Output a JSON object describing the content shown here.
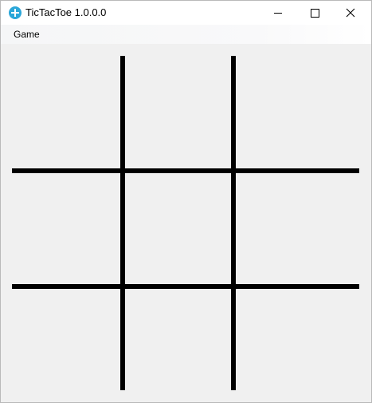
{
  "window": {
    "title": "TicTacToe 1.0.0.0",
    "app_icon": "tictactoe-app-icon",
    "controls": [
      "minimize-icon",
      "maximize-icon",
      "close-icon"
    ]
  },
  "menu": {
    "items": [
      {
        "label": "Game"
      }
    ]
  },
  "board": {
    "rows": 3,
    "cols": 3,
    "cells": [
      "",
      "",
      "",
      "",
      "",
      "",
      "",
      "",
      ""
    ],
    "line_color": "#000000",
    "background": "#f0f0f0"
  }
}
